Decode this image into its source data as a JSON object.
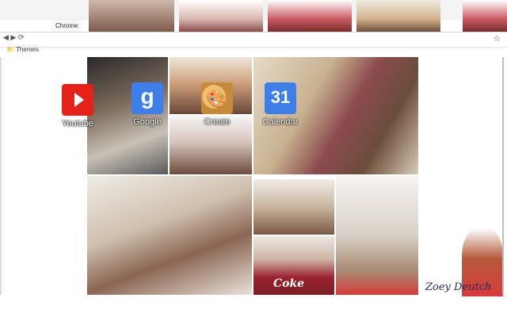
{
  "browser": {
    "tab_title": "Chrome",
    "bookmarks_label": "Themes",
    "star_icon": "star-icon"
  },
  "shortcuts": [
    {
      "label": "Youtube",
      "icon": "youtube-icon"
    },
    {
      "label": "Google",
      "icon": "google-icon",
      "glyph": "g"
    },
    {
      "label": "Create",
      "icon": "palette-icon",
      "glyph": "🎨"
    },
    {
      "label": "Calendar",
      "icon": "calendar-icon",
      "glyph": "31"
    }
  ],
  "collage": {
    "shirt_text": "Coke",
    "signature": "Zoey Deutch"
  },
  "colors": {
    "youtube": "#e62117",
    "google_blue": "#3d7ee8"
  }
}
